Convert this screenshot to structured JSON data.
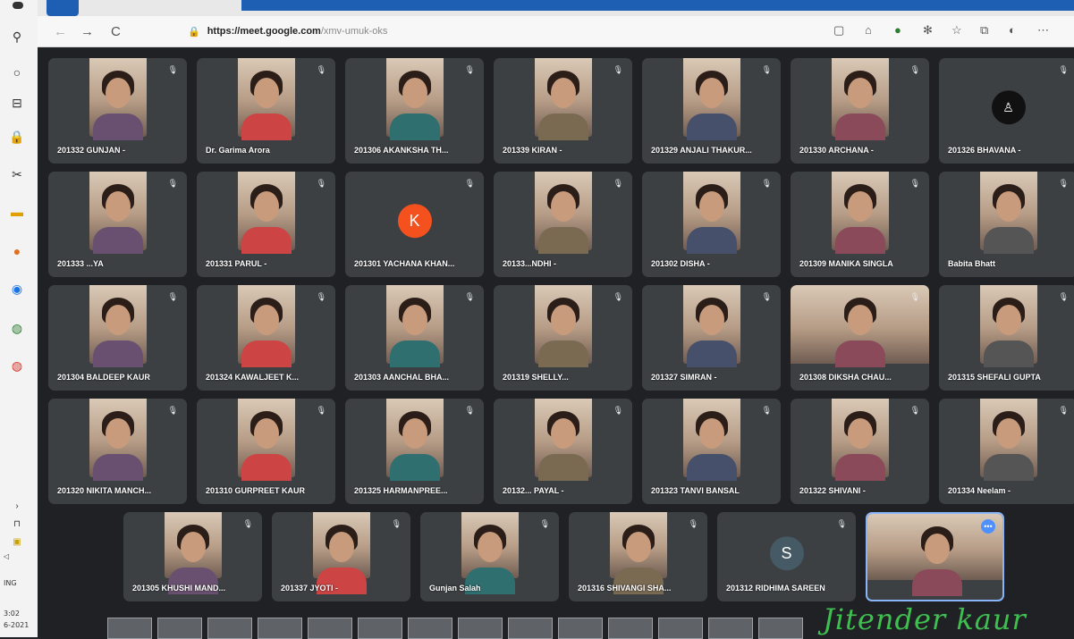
{
  "browser": {
    "url_host": "https://meet.google.com",
    "url_path": "/xmv-umuk-oks",
    "nav_back": "←",
    "nav_forward": "→",
    "nav_refresh": "C"
  },
  "taskbar": {
    "labels": [
      "ING",
      "3:02",
      "6-2021"
    ]
  },
  "colors": {
    "tile_bg": "#3c4043",
    "stage_bg": "#202124",
    "avatar_k": "#f4511e",
    "avatar_s": "#455a64",
    "signature": "#3fbf50"
  },
  "participants": [
    {
      "name": "201332 GUNJAN -"
    },
    {
      "name": "Dr. Garima Arora"
    },
    {
      "name": "201306 AKANKSHA TH..."
    },
    {
      "name": "201339 KIRAN -"
    },
    {
      "name": "201329 ANJALI THAKUR..."
    },
    {
      "name": "201330 ARCHANA -"
    },
    {
      "name": "201326 BHAVANA -"
    },
    {
      "name": "201333 ...YA"
    },
    {
      "name": "201331 PARUL -"
    },
    {
      "name": "201301 YACHANA KHAN...",
      "avatar_letter": "K"
    },
    {
      "name": "20133...NDHI -"
    },
    {
      "name": "201302 DISHA -"
    },
    {
      "name": "201309 MANIKA SINGLA"
    },
    {
      "name": "Babita Bhatt"
    },
    {
      "name": "201304 BALDEEP KAUR"
    },
    {
      "name": "201324 KAWALJEET K..."
    },
    {
      "name": "201303 AANCHAL BHA..."
    },
    {
      "name": "201319 SHELLY..."
    },
    {
      "name": "201327 SIMRAN -"
    },
    {
      "name": "201308 DIKSHA CHAU..."
    },
    {
      "name": "201315 SHEFALI GUPTA"
    },
    {
      "name": "201320 NIKITA MANCH..."
    },
    {
      "name": "201310 GURPREET KAUR"
    },
    {
      "name": "201325 HARMANPREE..."
    },
    {
      "name": "20132... PAYAL -"
    },
    {
      "name": "201323 TANVI BANSAL"
    },
    {
      "name": "201322 SHIVANI -"
    },
    {
      "name": "201334 Neelam -"
    },
    {
      "name": "201305 KHUSHI MAND..."
    },
    {
      "name": "201337 JYOTI -"
    },
    {
      "name": "Gunjan Salah"
    },
    {
      "name": "201316 SHIVANGI SHA..."
    },
    {
      "name": "201312 RIDHIMA SAREEN",
      "avatar_letter": "S"
    },
    {
      "name": ""
    }
  ],
  "signature": "Jitender kaur"
}
